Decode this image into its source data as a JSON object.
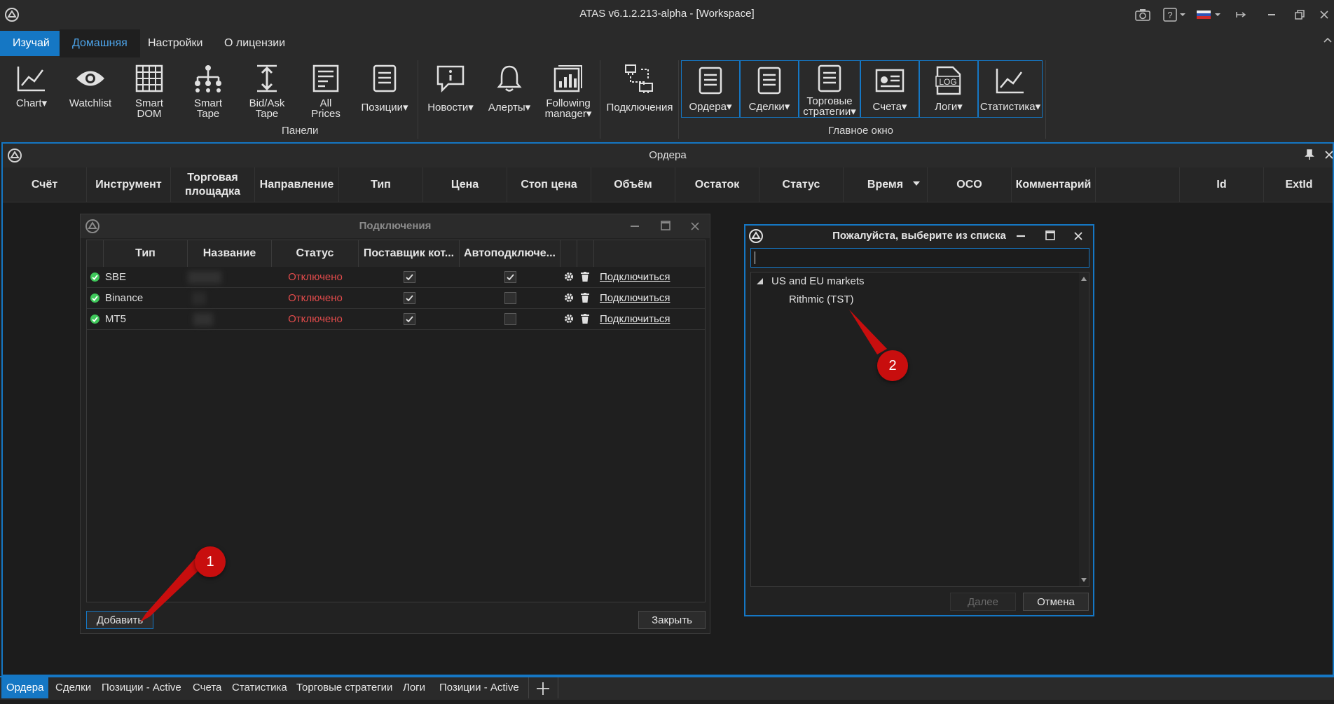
{
  "window": {
    "title": "ATAS v6.1.2.213-alpha - [Workspace]"
  },
  "ribbon_tabs": [
    "Изучай",
    "Домашняя",
    "Настройки",
    "О лицензии"
  ],
  "ribbon": {
    "panels_group": {
      "label": "Панели",
      "buttons": [
        {
          "label": "Chart",
          "icon": "chart-line-icon",
          "dropdown": true
        },
        {
          "label": "Watchlist",
          "icon": "eye-icon",
          "dropdown": false
        },
        {
          "label": "Smart DOM",
          "icon": "grid-table-icon",
          "dropdown": false
        },
        {
          "label": "Smart Tape",
          "icon": "tree-hierarchy-icon",
          "dropdown": false
        },
        {
          "label": "Bid/Ask Tape",
          "icon": "vertical-arrows-icon",
          "dropdown": false
        },
        {
          "label": "All Prices",
          "icon": "document-lines-icon",
          "dropdown": false
        },
        {
          "label": "Позиции",
          "icon": "list-document-icon",
          "dropdown": true
        },
        {
          "label": "Новости",
          "icon": "info-bubble-icon",
          "dropdown": true
        },
        {
          "label": "Алерты",
          "icon": "bell-icon",
          "dropdown": true
        },
        {
          "label": "Following manager",
          "icon": "bar-chart-doc-icon",
          "dropdown": true
        }
      ]
    },
    "connections_button": {
      "label": "Подключения",
      "icon": "network-icon"
    },
    "main_window_group": {
      "label": "Главное окно",
      "buttons": [
        {
          "label": "Ордера",
          "icon": "list-document-icon",
          "dropdown": true
        },
        {
          "label": "Сделки",
          "icon": "list-document-icon",
          "dropdown": true
        },
        {
          "label": "Торговые стратегии",
          "icon": "list-document-icon",
          "dropdown": true
        },
        {
          "label": "Счета",
          "icon": "account-card-icon",
          "dropdown": true
        },
        {
          "label": "Логи",
          "icon": "log-file-icon",
          "dropdown": true
        },
        {
          "label": "Статистика",
          "icon": "chart-line-icon",
          "dropdown": true
        }
      ]
    }
  },
  "orders_panel": {
    "title": "Ордера",
    "columns": [
      "Счёт",
      "Инструмент",
      "Торговая площадка",
      "Направление",
      "Тип",
      "Цена",
      "Стоп цена",
      "Объём",
      "Остаток",
      "Статус",
      "Время",
      "OCO",
      "Комментарий",
      "",
      "Id",
      "ExtId"
    ]
  },
  "connections_dialog": {
    "title": "Подключения",
    "columns": [
      "Тип",
      "Название",
      "Статус",
      "Поставщик кот...",
      "Автоподключе..."
    ],
    "rows": [
      {
        "type": "SBE",
        "status": "Отключено",
        "provider": true,
        "auto": true,
        "action": "Подключиться"
      },
      {
        "type": "Binance",
        "status": "Отключено",
        "provider": true,
        "auto": false,
        "action": "Подключиться"
      },
      {
        "type": "MT5",
        "status": "Отключено",
        "provider": true,
        "auto": false,
        "action": "Подключиться"
      }
    ],
    "add_button": "Добавить",
    "close_button": "Закрыть"
  },
  "choose_dialog": {
    "title": "Пожалуйста, выберите из списка",
    "search_value": "",
    "tree": {
      "group": "US and EU markets",
      "items": [
        "Rithmic (TST)"
      ]
    },
    "next_button": "Далее",
    "cancel_button": "Отмена"
  },
  "bottom_tabs": [
    "Ордера",
    "Сделки",
    "Позиции - Active",
    "Счета",
    "Статистика",
    "Торговые стратегии",
    "Логи",
    "Позиции - Active"
  ],
  "annotations": [
    "1",
    "2"
  ],
  "colors": {
    "accent": "#1577c4",
    "status_off": "#e14b4b",
    "status_ok": "#3ec85a",
    "annotation": "#c80e0e"
  }
}
